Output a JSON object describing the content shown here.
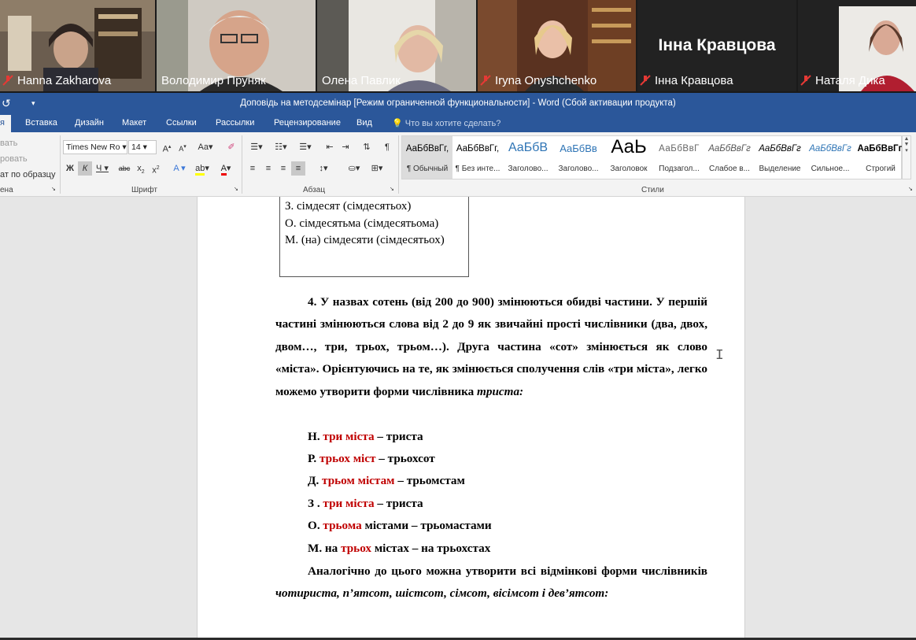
{
  "participants": [
    {
      "name": "Hanna Zakharova",
      "muted": true
    },
    {
      "name": "Володимир Пруняк",
      "muted": false,
      "active": true
    },
    {
      "name": "Олена Павлик",
      "muted": false
    },
    {
      "name": "Iryna Onyshchenko",
      "muted": true
    },
    {
      "name": "Інна Кравцова",
      "muted": true,
      "big_name": "Інна Кравцова"
    },
    {
      "name": "Наталя Дика",
      "muted": true
    }
  ],
  "word": {
    "title": "Доповідь на методсемінар [Режим ограниченной функциональности] - Word (Сбой активации продукта)",
    "tabs": [
      "я",
      "Вставка",
      "Дизайн",
      "Макет",
      "Ссылки",
      "Рассылки",
      "Рецензирование",
      "Вид"
    ],
    "tell_me": "Что вы хотите сделать?",
    "clipboard": {
      "cut": "вать",
      "copy": "ровать",
      "painter": "ат по образцу",
      "label": "ена"
    },
    "font": {
      "name": "Times New Ro",
      "size": "14",
      "label": "Шрифт"
    },
    "paragraph_label": "Абзац",
    "styles_label": "Стили",
    "styles": [
      {
        "preview": "АаБбВвГг,",
        "label": "¶ Обычный"
      },
      {
        "preview": "АаБбВвГг,",
        "label": "¶ Без инте..."
      },
      {
        "preview": "АаБбВ",
        "label": "Заголово..."
      },
      {
        "preview": "АаБбВв",
        "label": "Заголово..."
      },
      {
        "preview": "АаЬ",
        "label": "Заголовок"
      },
      {
        "preview": "АаБбВвГ",
        "label": "Подзагол..."
      },
      {
        "preview": "АаБбВвГг",
        "label": "Слабое в..."
      },
      {
        "preview": "АаБбВвГг",
        "label": "Выделение"
      },
      {
        "preview": "АаБбВвГг",
        "label": "Сильное..."
      },
      {
        "preview": "АаБбВвГг,",
        "label": "Строгий"
      }
    ]
  },
  "document": {
    "table_rows": [
      "З. сімдесят (сімдесятьох)",
      "О. сімдесятьма (сімдесятьома)",
      "М. (на) сімдесяти (сімдесятьох)"
    ],
    "para1": "4. У назвах сотень (від 200 до 900) змінюються обидві частини. У першій частині змінюються слова від 2 до 9 як звичайні прості числівники (два, двох, двом…, три, трьох, трьом…). Друга частина «сот» змінюється як слово «міста». Орієнтуючись на те, як змінюється сполучення слів «три міста», легко можемо утворити форми числівника",
    "para1_italic": "триста:",
    "cases": [
      {
        "case": "Н. ",
        "red": "три міста",
        "rest": " – триста"
      },
      {
        "case": "Р. ",
        "red": "трьох міст",
        "rest": " – трьохсот"
      },
      {
        "case": "Д. ",
        "red": "трьом містам",
        "rest": " – трьомстам"
      },
      {
        "case": "З . ",
        "red": "три міста",
        "rest": " – триста"
      },
      {
        "case": "О. ",
        "red": "трьома",
        "rest": " містами – трьомастами"
      },
      {
        "case": "М. на ",
        "red": "трьох",
        "rest": " містах – на трьохстах"
      }
    ],
    "para2": "Аналогічно до цього можна утворити всі відмінкові форми числівників",
    "para2_italic": "чотириста, п’ятсот, шістсот, сімсот, вісімсот і дев’ятсот:"
  }
}
